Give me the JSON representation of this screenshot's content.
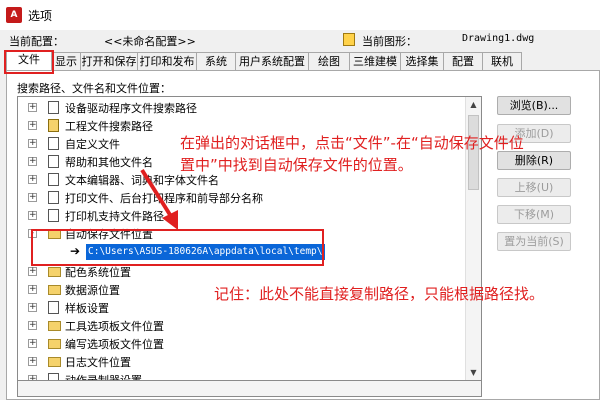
{
  "window": {
    "title": "选项"
  },
  "profile": {
    "current_profile_label": "当前配置：",
    "current_profile_value": "<<未命名配置>>",
    "current_drawing_label": "当前图形：",
    "current_drawing_value": "Drawing1.dwg"
  },
  "tabs": [
    "文件",
    "显示",
    "打开和保存",
    "打印和发布",
    "系统",
    "用户系统配置",
    "绘图",
    "三维建模",
    "选择集",
    "配置",
    "联机"
  ],
  "panel": {
    "section_label": "搜索路径、文件名和文件位置："
  },
  "tree": {
    "items": [
      {
        "label": "设备驱动程序文件搜索路径",
        "icon": "folder-tree-icon",
        "expander": "+"
      },
      {
        "label": "工程文件搜索路径",
        "icon": "project-files-icon",
        "expander": "+"
      },
      {
        "label": "自定义文件",
        "icon": "document-icon",
        "expander": "+"
      },
      {
        "label": "帮助和其他文件名",
        "icon": "document-icon",
        "expander": "+"
      },
      {
        "label": "文本编辑器、词典和字体文件名",
        "icon": "document-icon",
        "expander": "+"
      },
      {
        "label": "打印文件、后台打印程序和前导部分名称",
        "icon": "document-icon",
        "expander": "+"
      },
      {
        "label": "打印机支持文件路径",
        "icon": "document-icon",
        "expander": "+"
      },
      {
        "label": "自动保存文件位置",
        "icon": "folder-icon",
        "expander": "-"
      },
      {
        "label": "配色系统位置",
        "icon": "folder-icon",
        "expander": "+"
      },
      {
        "label": "数据源位置",
        "icon": "folder-icon",
        "expander": "+"
      },
      {
        "label": "样板设置",
        "icon": "document-icon",
        "expander": "+"
      },
      {
        "label": "工具选项板文件位置",
        "icon": "folder-icon",
        "expander": "+"
      },
      {
        "label": "编写选项板文件位置",
        "icon": "folder-icon",
        "expander": "+"
      },
      {
        "label": "日志文件位置",
        "icon": "folder-icon",
        "expander": "+"
      },
      {
        "label": "动作录制器设置",
        "icon": "document-icon",
        "expander": "+"
      }
    ],
    "autosave_path": "C:\\Users\\ASUS-180626A\\appdata\\local\\temp\\"
  },
  "buttons": {
    "browse": "浏览(B)...",
    "add": "添加(D)",
    "remove": "删除(R)",
    "move_up": "上移(U)",
    "move_down": "下移(M)",
    "set_current": "置为当前(S)"
  },
  "annotations": {
    "instruction_line1": "在弹出的对话框中，点击“文件”-在“自动保存文件位",
    "instruction_line2": "置中”中找到自动保存文件的位置。",
    "note": "记住：此处不能直接复制路径，只能根据路径找。"
  },
  "colors": {
    "annotation": "#e02020",
    "selection": "#0a66d8",
    "folder": "#f5d26b"
  }
}
